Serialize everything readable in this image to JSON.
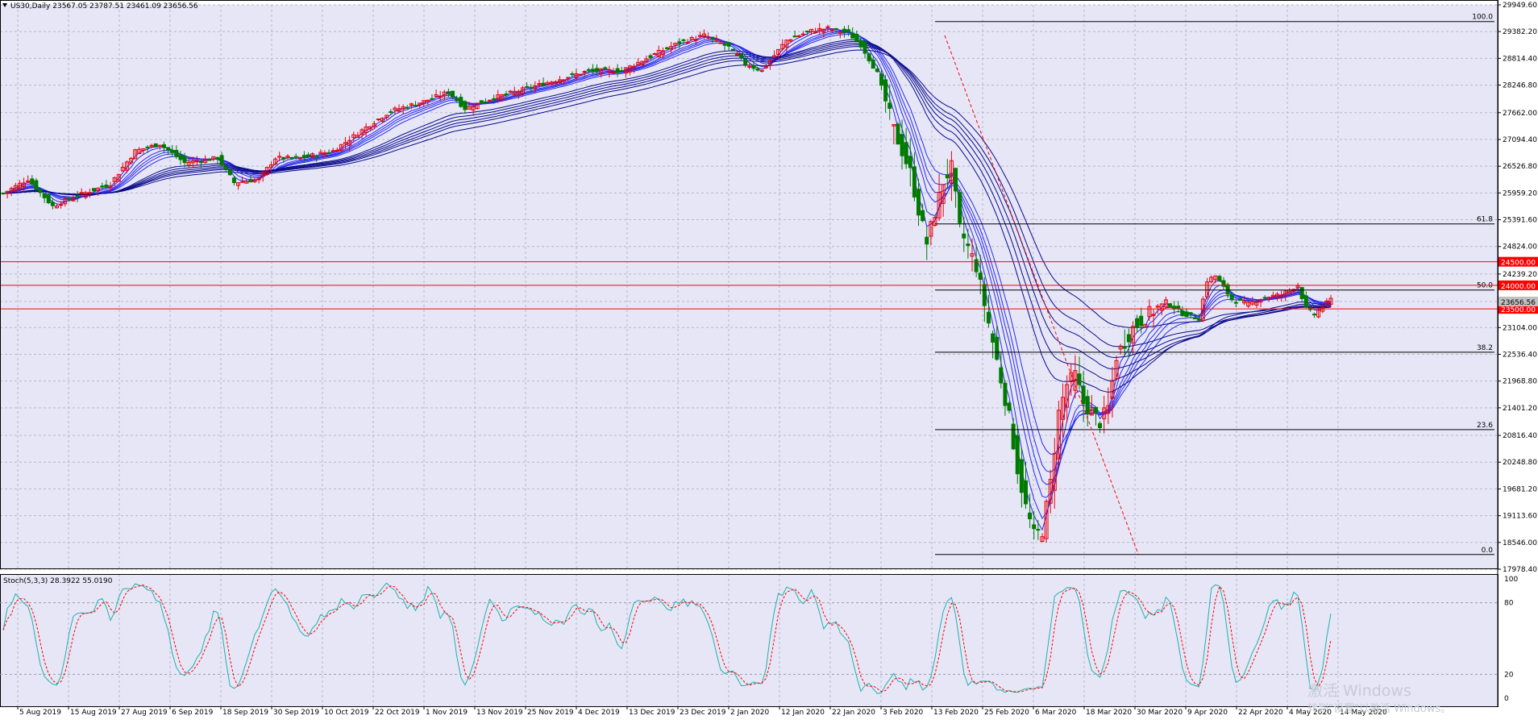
{
  "header": {
    "symbol_label": "US30,Daily",
    "ohlc": "23567.05 23787.51 23461.09 23656.56"
  },
  "stoch": {
    "label": "Stoch(5,3,3) 28.3922 55.0190",
    "ticks": [
      "100",
      "80",
      "20",
      "0"
    ]
  },
  "watermark": {
    "line1": "激活 Windows",
    "line2": "转到\"设置\"以激活 Windows。"
  },
  "colors": {
    "background": "#e6e6f7",
    "grid": "#b8b8cc",
    "bull": "#e8000b",
    "bear": "#007a00",
    "ribbon": "#1010d8",
    "level": "#ff0000",
    "fib": "#000000",
    "stoch_main": "#20b2aa",
    "stoch_signal": "#ff0000"
  },
  "chart_data": {
    "type": "candlestick",
    "y_ticks": [
      "29949.60",
      "29382.20",
      "28814.40",
      "28246.80",
      "27662.00",
      "27094.40",
      "26526.80",
      "25959.20",
      "25391.60",
      "24824.00",
      "24239.20",
      "23656.56",
      "23104.00",
      "22536.40",
      "21968.80",
      "21401.20",
      "20816.40",
      "20248.80",
      "19681.20",
      "19113.60",
      "18546.00",
      "17978.40"
    ],
    "x_ticks": [
      "5 Aug 2019",
      "15 Aug 2019",
      "27 Aug 2019",
      "6 Sep 2019",
      "18 Sep 2019",
      "30 Sep 2019",
      "10 Oct 2019",
      "22 Oct 2019",
      "1 Nov 2019",
      "13 Nov 2019",
      "25 Nov 2019",
      "4 Dec 2019",
      "13 Dec 2019",
      "23 Dec 2019",
      "2 Jan 2020",
      "12 Jan 2020",
      "22 Jan 2020",
      "3 Feb 2020",
      "13 Feb 2020",
      "25 Feb 2020",
      "6 Mar 2020",
      "18 Mar 2020",
      "30 Mar 2020",
      "9 Apr 2020",
      "22 Apr 2020",
      "4 May 2020",
      "14 May 2020"
    ],
    "price_levels": [
      {
        "value": 24500,
        "label": "24500.00"
      },
      {
        "value": 24000,
        "label": "24000.00"
      },
      {
        "value": 23500,
        "label": "23500.00"
      }
    ],
    "current_price": {
      "value": 23656.56,
      "label": "23656.56"
    },
    "fib_levels": [
      {
        "label": "100.0",
        "value": 29595
      },
      {
        "label": "61.8",
        "value": 25303
      },
      {
        "label": "50.0",
        "value": 23900
      },
      {
        "label": "38.2",
        "value": 22580
      },
      {
        "label": "23.6",
        "value": 20940
      },
      {
        "label": "0.0",
        "value": 18290
      }
    ],
    "anchors": [
      [
        0,
        25950
      ],
      [
        6,
        26250
      ],
      [
        12,
        25680
      ],
      [
        18,
        25900
      ],
      [
        26,
        26150
      ],
      [
        32,
        26850
      ],
      [
        38,
        27000
      ],
      [
        44,
        26600
      ],
      [
        52,
        26700
      ],
      [
        56,
        26180
      ],
      [
        62,
        26250
      ],
      [
        66,
        26700
      ],
      [
        72,
        26700
      ],
      [
        80,
        26850
      ],
      [
        88,
        27350
      ],
      [
        94,
        27700
      ],
      [
        102,
        27900
      ],
      [
        108,
        28100
      ],
      [
        112,
        27750
      ],
      [
        118,
        27950
      ],
      [
        126,
        28150
      ],
      [
        134,
        28350
      ],
      [
        142,
        28550
      ],
      [
        150,
        28550
      ],
      [
        158,
        28900
      ],
      [
        164,
        29150
      ],
      [
        170,
        29300
      ],
      [
        176,
        29050
      ],
      [
        180,
        28700
      ],
      [
        184,
        28550
      ],
      [
        190,
        29200
      ],
      [
        196,
        29400
      ],
      [
        200,
        29450
      ],
      [
        205,
        29350
      ],
      [
        208,
        29100
      ],
      [
        212,
        28500
      ],
      [
        216,
        27300
      ],
      [
        220,
        26400
      ],
      [
        222,
        25600
      ],
      [
        224,
        24900
      ],
      [
        228,
        26200
      ],
      [
        230,
        26500
      ],
      [
        232,
        25200
      ],
      [
        236,
        24400
      ],
      [
        240,
        22800
      ],
      [
        244,
        21200
      ],
      [
        246,
        20100
      ],
      [
        248,
        19300
      ],
      [
        250,
        18700
      ],
      [
        252,
        18800
      ],
      [
        254,
        19800
      ],
      [
        256,
        21300
      ],
      [
        258,
        21900
      ],
      [
        260,
        22100
      ],
      [
        262,
        21500
      ],
      [
        264,
        21300
      ],
      [
        266,
        21100
      ],
      [
        268,
        21400
      ],
      [
        270,
        22500
      ],
      [
        274,
        23100
      ],
      [
        278,
        23400
      ],
      [
        282,
        23650
      ],
      [
        286,
        23400
      ],
      [
        290,
        23300
      ],
      [
        292,
        24100
      ],
      [
        294,
        24200
      ],
      [
        298,
        23700
      ],
      [
        302,
        23600
      ],
      [
        306,
        23750
      ],
      [
        310,
        23800
      ],
      [
        312,
        23900
      ],
      [
        314,
        24000
      ],
      [
        316,
        23500
      ],
      [
        318,
        23380
      ],
      [
        320,
        23550
      ],
      [
        322,
        23700
      ]
    ],
    "x_range": [
      0,
      322
    ],
    "ylim": [
      17978.4,
      29949.6
    ],
    "stoch_range": [
      0,
      100
    ],
    "stoch_levels": [
      80,
      20
    ]
  }
}
